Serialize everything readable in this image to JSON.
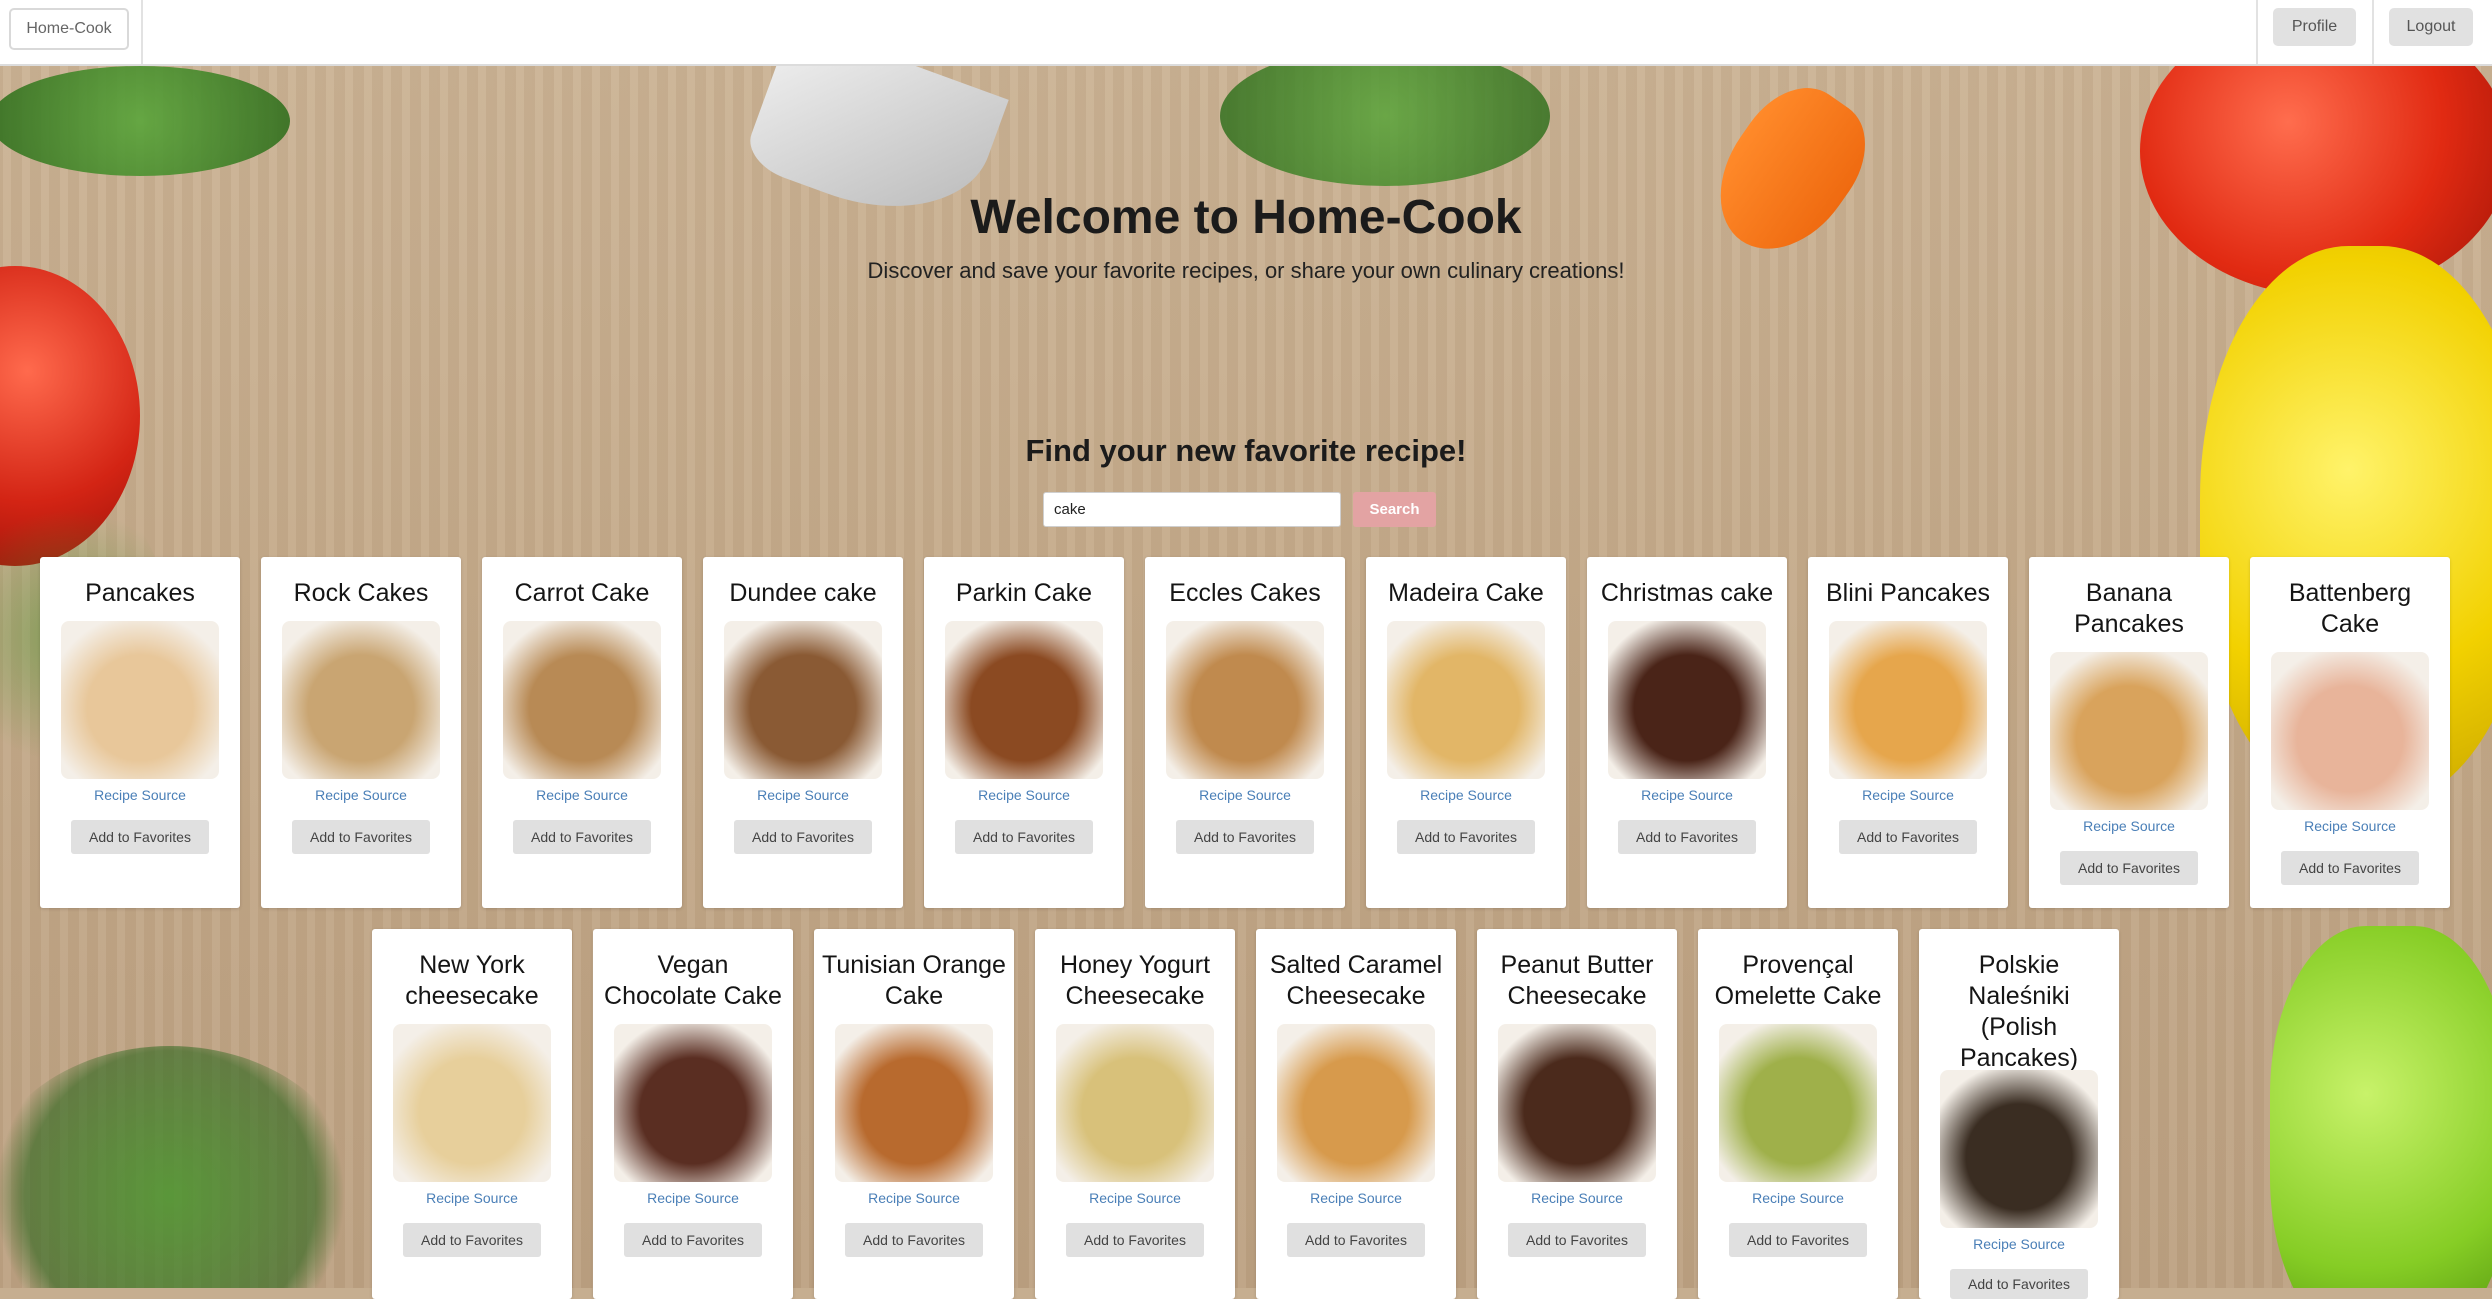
{
  "nav": {
    "brand": "Home-Cook",
    "profile": "Profile",
    "logout": "Logout"
  },
  "hero": {
    "title": "Welcome to Home-Cook",
    "subtitle": "Discover and save your favorite recipes, or share your own culinary creations!"
  },
  "search": {
    "heading": "Find your new favorite recipe!",
    "value": "cake",
    "button": "Search"
  },
  "card_labels": {
    "source": "Recipe Source",
    "favorite": "Add to Favorites"
  },
  "recipes_row1": [
    {
      "title": "Pancakes",
      "color": "#e8c79a"
    },
    {
      "title": "Rock Cakes",
      "color": "#c9a572"
    },
    {
      "title": "Carrot Cake",
      "color": "#b88a55"
    },
    {
      "title": "Dundee cake",
      "color": "#8a5a34"
    },
    {
      "title": "Parkin Cake",
      "color": "#8b4a22"
    },
    {
      "title": "Eccles Cakes",
      "color": "#c08a4e"
    },
    {
      "title": "Madeira Cake",
      "color": "#e2b667"
    },
    {
      "title": "Christmas cake",
      "color": "#4a2418"
    },
    {
      "title": "Blini Pancakes",
      "color": "#e6a64c"
    },
    {
      "title": "Banana Pancakes",
      "color": "#d9a35c"
    },
    {
      "title": "Battenberg Cake",
      "color": "#e8b49a"
    }
  ],
  "recipes_row2": [
    {
      "title": "New York cheesecake",
      "color": "#e7cf9b"
    },
    {
      "title": "Vegan Chocolate Cake",
      "color": "#5a2e22"
    },
    {
      "title": "Tunisian Orange Cake",
      "color": "#b86a2e"
    },
    {
      "title": "Honey Yogurt Cheesecake",
      "color": "#d8c17a"
    },
    {
      "title": "Salted Caramel Cheesecake",
      "color": "#d79a4c"
    },
    {
      "title": "Peanut Butter Cheesecake",
      "color": "#4b2a1c"
    },
    {
      "title": "Provençal Omelette Cake",
      "color": "#9fb04a"
    },
    {
      "title": "Polskie Naleśniki (Polish Pancakes)",
      "color": "#3a2d22"
    }
  ]
}
